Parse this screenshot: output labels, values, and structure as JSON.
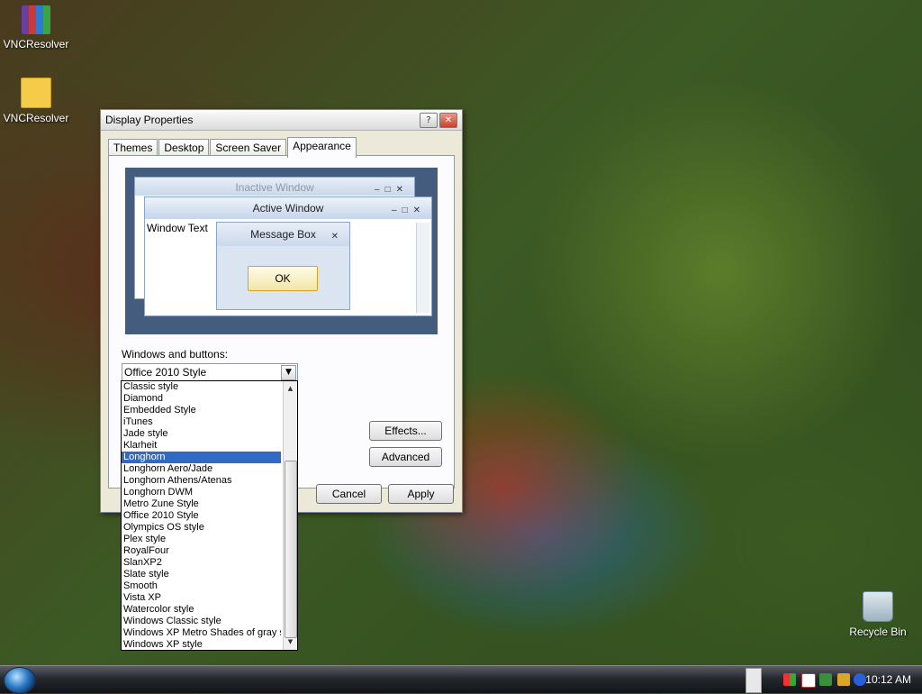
{
  "desktop": {
    "icons": [
      {
        "label": "VNCResolver",
        "type": "archive-icon"
      },
      {
        "label": "VNCResolver",
        "type": "folder-icon"
      },
      {
        "label": "Recycle Bin",
        "type": "recycle-bin-icon"
      }
    ]
  },
  "dialog": {
    "title": "Display Properties",
    "help_glyph": "?",
    "close_glyph": "✕",
    "tabs": [
      "Themes",
      "Desktop",
      "Screen Saver",
      "Appearance"
    ],
    "active_tab": "Appearance",
    "preview": {
      "inactive_title": "Inactive Window",
      "active_title": "Active Window",
      "window_text": "Window Text",
      "message_title": "Message Box",
      "ok_label": "OK"
    },
    "windows_buttons_label": "Windows and buttons:",
    "selected_style": "Office 2010 Style",
    "buttons": {
      "effects": "Effects...",
      "advanced": "Advanced",
      "cancel": "Cancel",
      "apply": "Apply"
    }
  },
  "dropdown": {
    "items": [
      "Classic style",
      "Diamond",
      "Embedded Style",
      "iTunes",
      "Jade style",
      "Klarheit",
      "Longhorn",
      "Longhorn Aero/Jade",
      "Longhorn Athens/Atenas",
      "Longhorn DWM",
      "Metro Zune Style",
      "Office 2010 Style",
      "Olympics OS style",
      "Plex style",
      "RoyalFour",
      "SlanXP2",
      "Slate style",
      "Smooth",
      "Vista XP",
      "Watercolor style",
      "Windows Classic style",
      "Windows XP Metro Shades of gray st",
      "Windows XP style"
    ],
    "highlighted": "Longhorn"
  },
  "taskbar": {
    "clock": "10:12 AM"
  }
}
